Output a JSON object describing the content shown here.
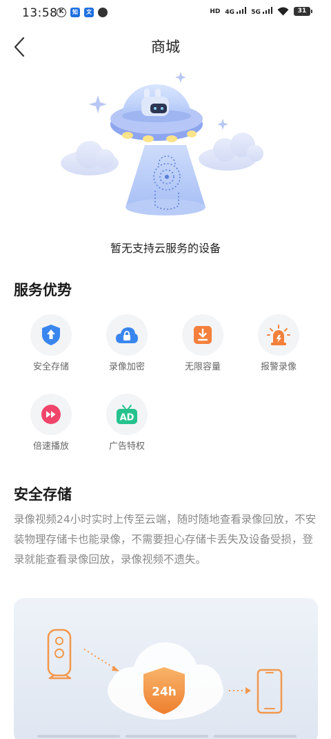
{
  "status_bar": {
    "time": "13:58",
    "left_icons": [
      "k-icon",
      "zhihu-icon",
      "translate-icon",
      "clock-icon"
    ],
    "network": [
      "HD",
      "4G",
      "5G"
    ],
    "battery": "31"
  },
  "header": {
    "title": "商城"
  },
  "empty_state": {
    "text": "暂无支持云服务的设备"
  },
  "advantages": {
    "title": "服务优势",
    "items": [
      {
        "label": "安全存储",
        "icon": "shield-upload-icon",
        "color": "#3a86ef"
      },
      {
        "label": "录像加密",
        "icon": "cloud-lock-icon",
        "color": "#3a86ef"
      },
      {
        "label": "无限容量",
        "icon": "download-box-icon",
        "color": "#f4803c"
      },
      {
        "label": "报警录像",
        "icon": "alarm-light-icon",
        "color": "#f4803c"
      },
      {
        "label": "倍速播放",
        "icon": "fast-forward-icon",
        "color": "#f0446a"
      },
      {
        "label": "广告特权",
        "icon": "ad-tv-icon",
        "color": "#26c28e"
      }
    ]
  },
  "secure_storage": {
    "title": "安全存储",
    "description": "录像视频24小时实时上传至云端，随时随地查看录像回放，不安装物理存储卡也能录像，不需要担心存储卡丢失及设备受损，登录就能查看录像回放，录像视频不遗失。",
    "badge": "24h"
  }
}
